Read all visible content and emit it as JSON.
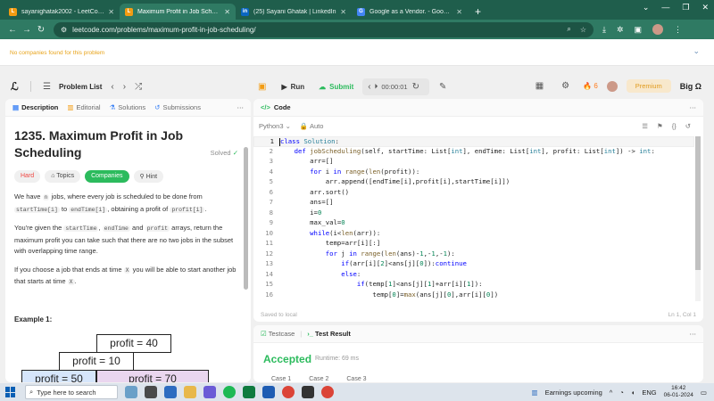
{
  "browser": {
    "tabs": [
      {
        "label": "sayanighatak2002 - LeetCode F",
        "fav": "L",
        "color": "#f39c12",
        "active": false
      },
      {
        "label": "Maximum Profit in Job Schedul",
        "fav": "L",
        "color": "#f39c12",
        "active": true
      },
      {
        "label": "(25) Sayani Ghatak | LinkedIn",
        "fav": "in",
        "color": "#0a66c2",
        "active": false
      },
      {
        "label": "Google as a Vendor. - Google S",
        "fav": "G",
        "color": "#4285f4",
        "active": false
      }
    ],
    "new_tab": "+",
    "url": "leetcode.com/problems/maximum-profit-in-job-scheduling/",
    "notice": "No companies found for this problem"
  },
  "lc_header": {
    "problem_list": "Problem List",
    "run": "Run",
    "submit": "Submit",
    "timer": "00:00:01",
    "streak": "6",
    "premium": "Premium",
    "bigo": "Big Ω"
  },
  "left_tabs": {
    "description": "Description",
    "editorial": "Editorial",
    "solutions": "Solutions",
    "submissions": "Submissions"
  },
  "problem": {
    "title": "1235. Maximum Profit in Job Scheduling",
    "solved": "Solved",
    "chips": {
      "hard": "Hard",
      "topics": "Topics",
      "companies": "Companies",
      "hint": "Hint"
    },
    "p1": {
      "a": "We have ",
      "n": "n",
      "b": " jobs, where every job is scheduled to be done from ",
      "st": "startTime[i]",
      "c": " to ",
      "et": "endTime[i]",
      "d": ", obtaining a profit of ",
      "pr": "profit[i]",
      "e": "."
    },
    "p2": {
      "a": "You're given the ",
      "st": "startTime",
      "b": ", ",
      "et": "endTime",
      "c": " and ",
      "pr": "profit",
      "d": " arrays, return the maximum profit you can take such that there are no two jobs in the subset with overlapping time range."
    },
    "p3": {
      "a": "If you choose a job that ends at time ",
      "x1": "X",
      "b": " you will be able to start another job that starts at time ",
      "x2": "X",
      "c": "."
    },
    "example_title": "Example 1:",
    "diagram": {
      "p40": "profit = 40",
      "p10": "profit = 10",
      "p50": "profit = 50",
      "p70": "profit = 70"
    }
  },
  "code_panel": {
    "title": "Code",
    "language": "Python3",
    "auto": "Auto",
    "saved": "Saved to local",
    "position": "Ln 1, Col 1",
    "lines": [
      "1",
      "2",
      "3",
      "4",
      "5",
      "6",
      "7",
      "8",
      "9",
      "10",
      "11",
      "12",
      "13",
      "14",
      "15",
      "16"
    ]
  },
  "result_panel": {
    "testcase": "Testcase",
    "test_result": "Test Result",
    "accepted": "Accepted",
    "runtime": "Runtime: 69 ms",
    "case1": "Case 1",
    "case2": "Case 2",
    "case3": "Case 3"
  },
  "taskbar": {
    "search": "Type here to search",
    "earnings": "Earnings upcoming",
    "lang": "ENG",
    "time": "16:42",
    "date": "06-01-2024"
  },
  "colors": {
    "accent_green": "#2cbb5d",
    "chrome_green": "#2f7a63",
    "hard_red": "#ef4743"
  }
}
